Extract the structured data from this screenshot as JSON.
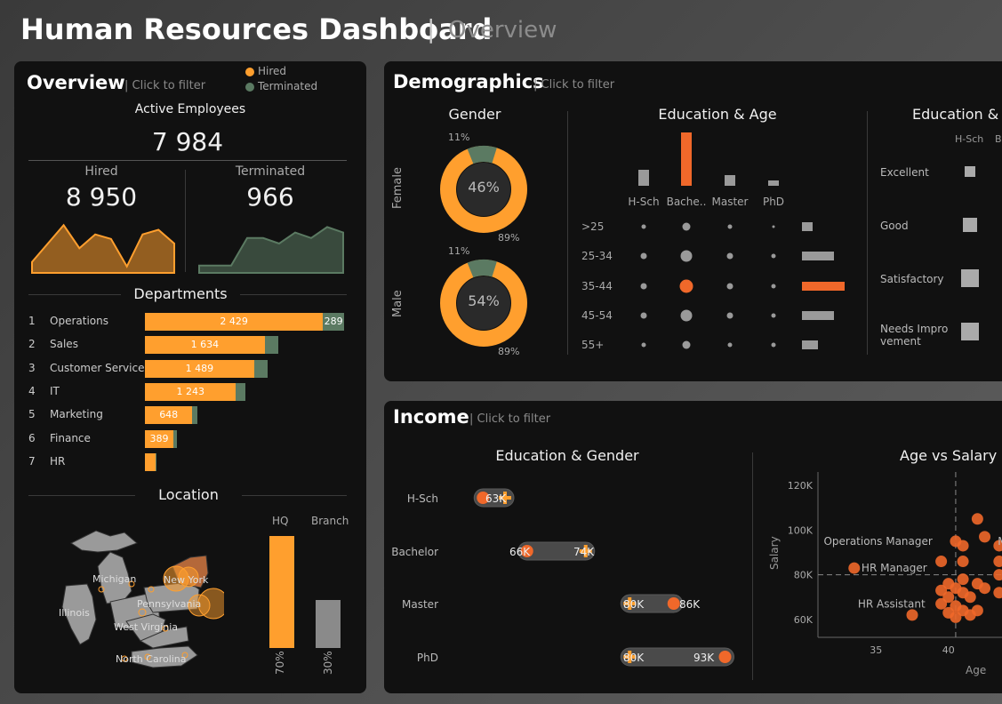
{
  "header": {
    "title": "Human Resources Dashboard",
    "separator": "|",
    "subtitle": "Overview"
  },
  "colors": {
    "hired": "#ff9f2e",
    "terminated": "#5b7a62",
    "accent": "#f0682a",
    "grey": "#9a9a9a"
  },
  "overview": {
    "title": "Overview",
    "hint": "| Click to filter",
    "legend": [
      "Hired",
      "Terminated"
    ],
    "active_label": "Active Employees",
    "active_value": "7 984",
    "hired_label": "Hired",
    "hired_value": "8 950",
    "terminated_label": "Terminated",
    "terminated_value": "966",
    "departments_title": "Departments",
    "location_title": "Location",
    "hq_label": "HQ",
    "branch_label": "Branch",
    "hq_pct": "70%",
    "branch_pct": "30%",
    "states": [
      "Michigan",
      "New York",
      "Pennsylvania",
      "Illinois",
      "West Virginia",
      "North Carolina"
    ]
  },
  "demographics": {
    "title": "Demographics",
    "hint": "| Click to filter",
    "gender_title": "Gender",
    "female_label": "Female",
    "male_label": "Male",
    "female": {
      "center": "46%",
      "top": "11%",
      "bottom": "89%"
    },
    "male": {
      "center": "54%",
      "top": "11%",
      "bottom": "89%"
    },
    "edu_age_title": "Education & Age",
    "edu_perf_title": "Education &",
    "edu_perf_cols": [
      "H-Sch",
      "B"
    ],
    "perf_rows": [
      "Excellent",
      "Good",
      "Satisfactory",
      "Needs Impro vement"
    ]
  },
  "income": {
    "title": "Income",
    "hint": "| Click to filter",
    "edu_gender_title": "Education & Gender",
    "age_salary_title": "Age vs Salary",
    "ylabel": "Salary",
    "xlabel": "Age",
    "annotations": [
      "Operations Manager",
      "HR Manager",
      "HR Assistant",
      "Ma"
    ]
  },
  "chart_data": [
    {
      "type": "area",
      "title": "Hired",
      "values": [
        2,
        6,
        10,
        5,
        8,
        7,
        1,
        8,
        9,
        6
      ],
      "ylim": [
        0,
        12
      ]
    },
    {
      "type": "area",
      "title": "Terminated",
      "values": [
        1,
        1,
        1,
        6,
        6,
        5,
        7,
        6,
        8,
        7
      ],
      "ylim": [
        0,
        10
      ]
    },
    {
      "type": "bar",
      "title": "Departments",
      "categories": [
        "Operations",
        "Sales",
        "Customer Service",
        "IT",
        "Marketing",
        "Finance",
        "HR"
      ],
      "ranks": [
        "1",
        "2",
        "3",
        "4",
        "5",
        "6",
        "7"
      ],
      "series": [
        {
          "name": "Hired",
          "values": [
            2429,
            1634,
            1489,
            1243,
            648,
            389,
            150
          ],
          "labels": [
            "2 429",
            "1 634",
            "1 489",
            "1 243",
            "648",
            "389",
            ""
          ]
        },
        {
          "name": "Terminated",
          "values": [
            289,
            190,
            180,
            130,
            70,
            45,
            12
          ],
          "labels": [
            "289",
            "",
            "",
            "",
            "",
            "",
            ""
          ]
        }
      ]
    },
    {
      "type": "bar",
      "title": "Location",
      "categories": [
        "HQ",
        "Branch"
      ],
      "values": [
        70,
        30
      ]
    },
    {
      "type": "pie",
      "title": "Gender",
      "series": [
        {
          "name": "Female",
          "values": [
            89,
            11
          ]
        },
        {
          "name": "Male",
          "values": [
            89,
            11
          ]
        }
      ]
    },
    {
      "type": "bar",
      "title": "Education",
      "categories": [
        "H-Sch",
        "Bache..",
        "Master",
        "PhD"
      ],
      "values": [
        3,
        10,
        2,
        1
      ]
    },
    {
      "type": "bar",
      "title": "Age",
      "categories": [
        ">25",
        "25-34",
        "35-44",
        "45-54",
        "55+"
      ],
      "values": [
        2,
        6,
        8,
        6,
        3
      ]
    },
    {
      "type": "scatter",
      "title": "Education & Age",
      "x": [
        "H-Sch",
        "Bache..",
        "Master",
        "PhD"
      ],
      "y": [
        ">25",
        "25-34",
        "35-44",
        "45-54",
        "55+"
      ],
      "values": [
        [
          1,
          3,
          1,
          0
        ],
        [
          2,
          5,
          2,
          1
        ],
        [
          2,
          6,
          2,
          1
        ],
        [
          2,
          5,
          2,
          1
        ],
        [
          1,
          3,
          1,
          1
        ]
      ]
    },
    {
      "type": "bar",
      "title": "Education & Performance",
      "categories": [
        "Excellent",
        "Good",
        "Satisfactory",
        "Needs Impro vement"
      ],
      "series": [
        {
          "name": "H-Sch",
          "values": [
            1,
            2,
            3,
            3
          ]
        }
      ]
    },
    {
      "type": "scatter",
      "title": "Education & Gender",
      "categories": [
        "H-Sch",
        "Bachelor",
        "Master",
        "PhD"
      ],
      "series": [
        {
          "name": "Female",
          "values": [
            60,
            66,
            86,
            93
          ]
        },
        {
          "name": "Male",
          "values": [
            63,
            74,
            80,
            80
          ]
        }
      ],
      "labels": {
        "H-Sch": [
          "63K"
        ],
        "Bachelor": [
          "66K",
          "74K"
        ],
        "Master": [
          "80K",
          "86K"
        ],
        "PhD": [
          "80K",
          "93K"
        ]
      },
      "xlim": [
        55,
        95
      ]
    },
    {
      "type": "scatter",
      "title": "Age vs Salary",
      "xlabel": "Age",
      "ylabel": "Salary",
      "xticks": [
        "35",
        "40"
      ],
      "yticks": [
        "60K",
        "80K",
        "100K",
        "120K"
      ],
      "xlim": [
        31,
        44
      ],
      "ylim": [
        52,
        126
      ],
      "points": [
        [
          33.5,
          83
        ],
        [
          37.5,
          62
        ],
        [
          40.5,
          95
        ],
        [
          41,
          93
        ],
        [
          42,
          105
        ],
        [
          39.5,
          86
        ],
        [
          41,
          86
        ],
        [
          43.5,
          86
        ],
        [
          42.5,
          97
        ],
        [
          43.5,
          93
        ],
        [
          40,
          76
        ],
        [
          40.5,
          74
        ],
        [
          41,
          72
        ],
        [
          40,
          70
        ],
        [
          41.5,
          70
        ],
        [
          42,
          76
        ],
        [
          39.5,
          67
        ],
        [
          40.5,
          66
        ],
        [
          41,
          64
        ],
        [
          40,
          63
        ],
        [
          41.5,
          62
        ],
        [
          40.5,
          61
        ],
        [
          42,
          64
        ],
        [
          43.5,
          80
        ],
        [
          43.5,
          72
        ],
        [
          39.5,
          73
        ],
        [
          42.5,
          74
        ],
        [
          41,
          78
        ]
      ]
    }
  ]
}
